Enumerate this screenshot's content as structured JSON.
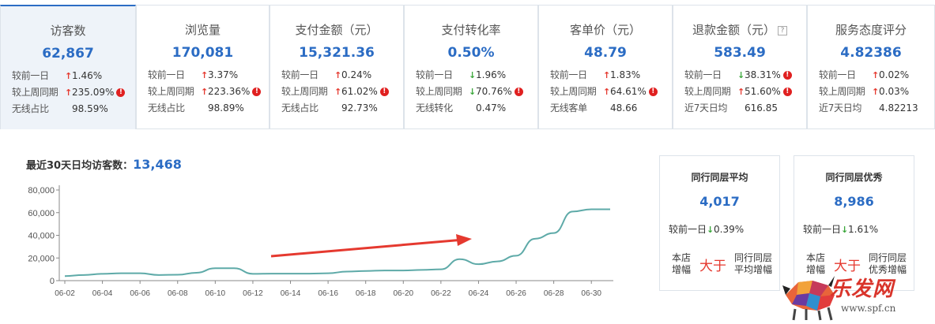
{
  "metrics": [
    {
      "title": "访客数",
      "value": "62,867",
      "help": false,
      "rows": [
        {
          "label": "较前一日",
          "dir": "up",
          "value": "1.46%",
          "warn": false
        },
        {
          "label": "较上周同期",
          "dir": "up",
          "value": "235.09%",
          "warn": true
        },
        {
          "label": "无线占比",
          "dir": "",
          "value": "98.59%",
          "warn": false
        }
      ]
    },
    {
      "title": "浏览量",
      "value": "170,081",
      "help": false,
      "rows": [
        {
          "label": "较前一日",
          "dir": "up",
          "value": "3.37%",
          "warn": false
        },
        {
          "label": "较上周同期",
          "dir": "up",
          "value": "223.36%",
          "warn": true
        },
        {
          "label": "无线占比",
          "dir": "",
          "value": "98.89%",
          "warn": false
        }
      ]
    },
    {
      "title": "支付金额（元）",
      "value": "15,321.36",
      "help": false,
      "rows": [
        {
          "label": "较前一日",
          "dir": "up",
          "value": "0.24%",
          "warn": false
        },
        {
          "label": "较上周同期",
          "dir": "up",
          "value": "61.02%",
          "warn": true
        },
        {
          "label": "无线占比",
          "dir": "",
          "value": "92.73%",
          "warn": false
        }
      ]
    },
    {
      "title": "支付转化率",
      "value": "0.50%",
      "help": false,
      "rows": [
        {
          "label": "较前一日",
          "dir": "down",
          "value": "1.96%",
          "warn": false
        },
        {
          "label": "较上周同期",
          "dir": "down",
          "value": "70.76%",
          "warn": true
        },
        {
          "label": "无线转化",
          "dir": "",
          "value": "0.47%",
          "warn": false
        }
      ]
    },
    {
      "title": "客单价（元）",
      "value": "48.79",
      "help": false,
      "rows": [
        {
          "label": "较前一日",
          "dir": "up",
          "value": "1.83%",
          "warn": false
        },
        {
          "label": "较上周同期",
          "dir": "up",
          "value": "64.61%",
          "warn": true
        },
        {
          "label": "无线客单",
          "dir": "",
          "value": "48.66",
          "warn": false
        }
      ]
    },
    {
      "title": "退款金额（元）",
      "value": "583.49",
      "help": true,
      "rows": [
        {
          "label": "较前一日",
          "dir": "down",
          "value": "38.31%",
          "warn": true
        },
        {
          "label": "较上周同期",
          "dir": "up",
          "value": "51.60%",
          "warn": true
        },
        {
          "label": "近7天日均",
          "dir": "",
          "value": "616.85",
          "warn": false
        }
      ]
    },
    {
      "title": "服务态度评分",
      "value": "4.82386",
      "help": false,
      "rows": [
        {
          "label": "较前一日",
          "dir": "up",
          "value": "0.02%",
          "warn": false
        },
        {
          "label": "较上周同期",
          "dir": "up",
          "value": "0.03%",
          "warn": false
        },
        {
          "label": "近7天日均",
          "dir": "",
          "value": "4.82213",
          "warn": false
        }
      ]
    }
  ],
  "chart": {
    "title_label": "最近30天日均访客数：",
    "title_value": "13,468"
  },
  "chart_data": {
    "type": "line",
    "x": [
      "06-02",
      "06-03",
      "06-04",
      "06-05",
      "06-06",
      "06-07",
      "06-08",
      "06-09",
      "06-10",
      "06-11",
      "06-12",
      "06-13",
      "06-14",
      "06-15",
      "06-16",
      "06-17",
      "06-18",
      "06-19",
      "06-20",
      "06-21",
      "06-22",
      "06-23",
      "06-24",
      "06-25",
      "06-26",
      "06-27",
      "06-28",
      "06-29",
      "06-30",
      "07-01"
    ],
    "x_tick_labels": [
      "06-02",
      "06-04",
      "06-06",
      "06-08",
      "06-10",
      "06-12",
      "06-14",
      "06-16",
      "06-18",
      "06-20",
      "06-22",
      "06-24",
      "06-26",
      "06-28",
      "06-30"
    ],
    "series": [
      {
        "values": [
          4000,
          5000,
          6000,
          6500,
          6500,
          5000,
          5200,
          7000,
          11000,
          11000,
          6000,
          6200,
          6200,
          6200,
          6500,
          8000,
          8500,
          9000,
          9000,
          9500,
          10000,
          19000,
          14500,
          17000,
          22000,
          37000,
          42000,
          61000,
          63000,
          63000
        ]
      }
    ],
    "yticks": [
      0,
      20000,
      40000,
      60000,
      80000
    ],
    "ytick_labels": [
      "0",
      "20,000",
      "40,000",
      "60,000",
      "80,000"
    ],
    "ylim": [
      0,
      80000
    ],
    "line_color": "#5eaaa8",
    "annotation_arrow_color": "#e5392f"
  },
  "peers": [
    {
      "title": "同行同层平均",
      "value": "4,017",
      "row_label": "较前一日",
      "dir": "down",
      "row_value": "0.39%",
      "cmp_left": "本店增幅",
      "cmp_mid": "大于",
      "cmp_right": "同行同层平均增幅"
    },
    {
      "title": "同行同层优秀",
      "value": "8,986",
      "row_label": "较前一日",
      "dir": "down",
      "row_value": "1.61%",
      "cmp_left": "本店增幅",
      "cmp_mid": "大于",
      "cmp_right": "同行同层优秀增幅"
    }
  ],
  "watermark": {
    "text": "乐发网",
    "url": "www.spf.cn"
  },
  "colors": {
    "accent": "#2b6cc4",
    "up": "#e5392f",
    "down": "#3aa63a",
    "warn": "#e02020"
  }
}
